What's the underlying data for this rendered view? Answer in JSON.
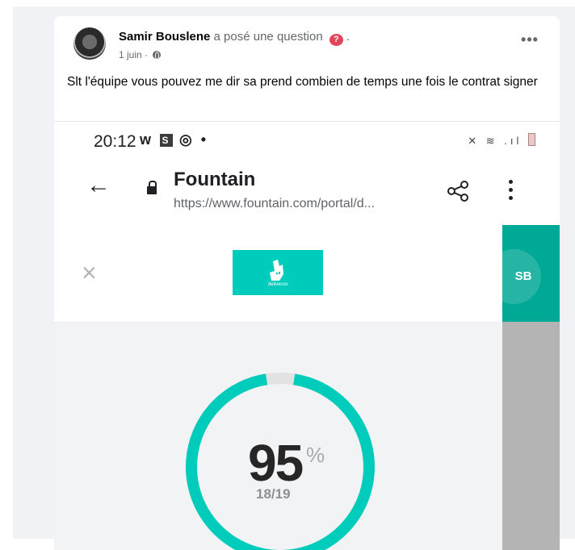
{
  "post": {
    "author": "Samir Bouslene",
    "action": "a posé une question",
    "action_trailing": ".",
    "date": "1 juin",
    "meta_separator": "·",
    "more_label": "•••",
    "text": "Slt l'équipe vous pouvez me dir sa prend combien de temps une fois le contrat signer"
  },
  "phone": {
    "status_time": "20:12",
    "status_apps_w": "w",
    "status_apps_s": "S",
    "status_apps_rest": "◎ •",
    "status_right": "✕ ≋ .ıl"
  },
  "browser": {
    "title": "Fountain",
    "url": "https://www.fountain.com/portal/d...",
    "back_glyph": "←"
  },
  "portal": {
    "close_glyph": "×",
    "logo_text": "deliveroo",
    "avatar_initials": "SB",
    "progress": {
      "percent": "95",
      "percent_sign": "%",
      "count": "18/19",
      "fraction": 0.95
    }
  },
  "colors": {
    "accent_teal": "#00ccbc",
    "dark_teal": "#00a896",
    "question_badge": "#e4455a"
  }
}
